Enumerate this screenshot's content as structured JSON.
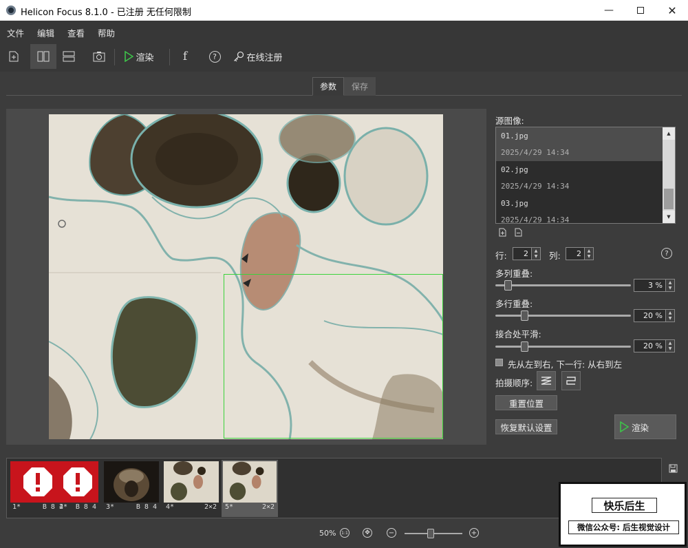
{
  "window": {
    "title": "Helicon Focus 8.1.0 - 已注册  无任何限制",
    "controls": [
      "minimize-icon",
      "maximize-icon",
      "close-icon"
    ]
  },
  "menu": [
    "文件",
    "编辑",
    "查看",
    "帮助"
  ],
  "toolbar": {
    "render_label": "渲染",
    "register_label": "在线注册",
    "icons": [
      "add-file-icon",
      "split-vertical-icon",
      "split-horizontal-icon",
      "camera-icon",
      "play-icon",
      "facebook-icon",
      "help-icon",
      "key-icon"
    ]
  },
  "tabs": [
    {
      "label": "参数",
      "active": true
    },
    {
      "label": "保存",
      "active": false
    }
  ],
  "panel": {
    "source_label": "源图像:",
    "sources": [
      {
        "name": "01.jpg",
        "date": "2025/4/29 14:34",
        "selected": true
      },
      {
        "name": "02.jpg",
        "date": "2025/4/29 14:34",
        "selected": false
      },
      {
        "name": "03.jpg",
        "date": "2025/4/29 14:34",
        "selected": false
      }
    ],
    "rows_label": "行:",
    "rows_value": "2",
    "cols_label": "列:",
    "cols_value": "2",
    "col_overlap_label": "多列重叠:",
    "col_overlap_value": "3 %",
    "col_overlap_level": 0.03,
    "row_overlap_label": "多行重叠:",
    "row_overlap_value": "20 %",
    "row_overlap_level": 0.2,
    "smooth_label": "接合处平滑:",
    "smooth_value": "20 %",
    "smooth_level": 0.2,
    "order_checkbox_label": "先从左到右, 下一行: 从右到左",
    "order_checked": false,
    "shoot_order_label": "拍摄顺序:",
    "reset_position_label": "重置位置",
    "restore_defaults_label": "恢复默认设置",
    "render_button_label": "渲染"
  },
  "filmstrip": [
    {
      "num": "1*",
      "info": "B 8 4",
      "kind": "error"
    },
    {
      "num": "2*",
      "info": "B 8 4",
      "kind": "error"
    },
    {
      "num": "3*",
      "info": "B 8 4",
      "kind": "photo"
    },
    {
      "num": "4*",
      "info": "2×2",
      "kind": "mosaic"
    },
    {
      "num": "5*",
      "info": "2×2",
      "kind": "mosaic",
      "selected": true
    }
  ],
  "zoom": {
    "percent": "50%",
    "fit_label": "1:1",
    "level": 0.45
  },
  "watermark": {
    "top": "快乐后生",
    "bottom": "微信公众号: 后生视觉设计"
  },
  "colors": {
    "selection": "#39d33a",
    "error_red": "#c8141c",
    "play_green": "#3ec34a"
  }
}
